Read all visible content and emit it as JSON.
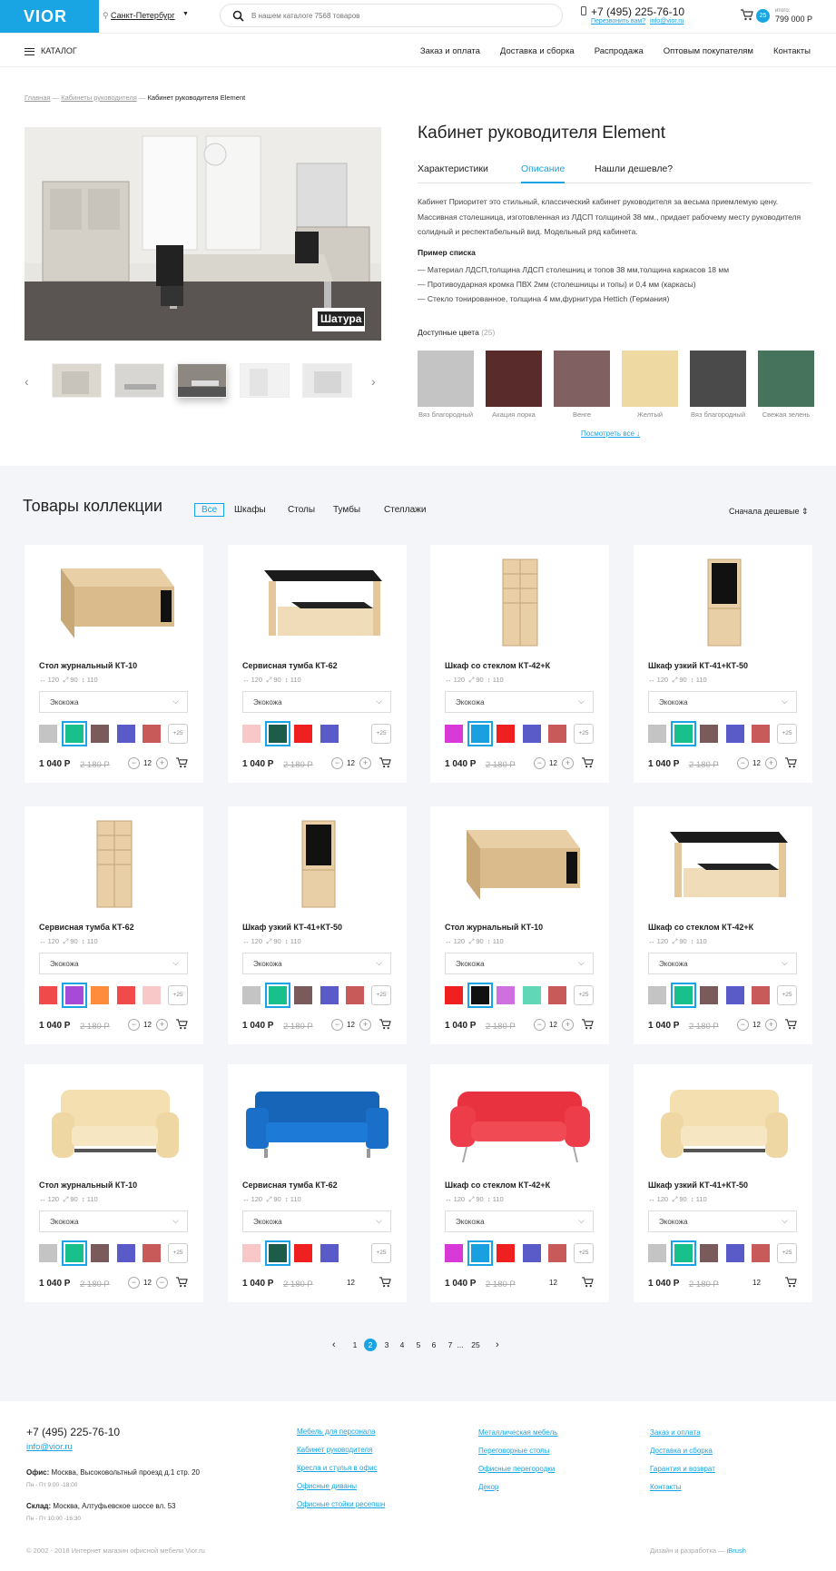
{
  "header": {
    "logo": "VIOR",
    "city": "Санкт-Петербург",
    "search_placeholder": "В нашем каталоге 7568 товаров",
    "phone": "+7 (495) 225-76-10",
    "callback": "Перезвонить вам?",
    "email": "info@vior.ru",
    "cart_count": "25",
    "cart_label": "итого:",
    "cart_total": "799 000 Р"
  },
  "nav": {
    "catalog": "КАТАЛОГ",
    "links": [
      "Заказ и оплата",
      "Доставка и сборка",
      "Распродажа",
      "Оптовым покупателям",
      "Контакты"
    ]
  },
  "breadcrumb": {
    "home": "Главная",
    "cat": "Кабинеты руководителя",
    "current": "Кабинет руководителя Element"
  },
  "product": {
    "brand": "Шатура",
    "title": "Кабинет руководителя Element",
    "tabs": [
      "Характеристики",
      "Описание",
      "Нашли дешевле?"
    ],
    "description": "Кабинет Приоритет это стильный, классический кабинет руководителя за весьма приемлемую цену. Массивная столешница, изготовленная из ЛДСП толщиной 38 мм., придает рабочему месту руководителя солидный и респектабельный вид. Модельный ряд кабинета.",
    "list_title": "Пример списка",
    "list": [
      "— Материал ЛДСП,толщина ЛДСП столешниц и топов 38 мм,толщина каркасов 18 мм",
      "— Противоударная кромка ПВХ 2мм (столешницы и топы) и 0,4 мм (каркасы)",
      "— Стекло тонированное, толщина 4 мм,фурнитура Hettich (Германия)"
    ],
    "colors_title": "Доступные цвета",
    "colors_count": "(25)",
    "colors": [
      {
        "name": "Вяз благородный",
        "hex": "#c4c4c4"
      },
      {
        "name": "Акация лорка",
        "hex": "#5a2b2b"
      },
      {
        "name": "Венге",
        "hex": "#806060"
      },
      {
        "name": "Желтый",
        "hex": "#efd9a2"
      },
      {
        "name": "Вяз благородный",
        "hex": "#4a4a4a"
      },
      {
        "name": "Свежая зелень",
        "hex": "#46735c"
      }
    ],
    "view_all": "Посмотреть все"
  },
  "collection": {
    "title": "Товары коллекции",
    "filters": [
      "Все",
      "Шкафы",
      "Столы",
      "Тумбы",
      "Стеллажи"
    ],
    "sort": "Сначала дешевые",
    "cards": [
      {
        "name": "Стол журнальный КТ-10",
        "img": "desk",
        "dims": [
          "120",
          "90",
          "110"
        ],
        "material": "Экокожа",
        "price": "1 040 Р",
        "old": "2 180 Р",
        "qty": "12",
        "colors": [
          "#c4c4c4",
          "#18c08c",
          "#7a5a5a",
          "#5a5ac8",
          "#c85a5a"
        ],
        "active": 1
      },
      {
        "name": "Сервисная тумба КТ-62",
        "img": "table",
        "dims": [
          "120",
          "90",
          "110"
        ],
        "material": "Экокожа",
        "price": "1 040 Р",
        "old": "2 180 Р",
        "qty": "12",
        "colors": [
          "#f8c8c8",
          "#1e5c4a",
          "#f02020",
          "#5a5ac8"
        ],
        "active": 1
      },
      {
        "name": "Шкаф со стеклом КТ-42+К",
        "img": "shelf",
        "dims": [
          "120",
          "90",
          "110"
        ],
        "material": "Экокожа",
        "price": "1 040 Р",
        "old": "2 180 Р",
        "qty": "12",
        "colors": [
          "#d83ad8",
          "#18a0e0",
          "#f02020",
          "#5a5ac8",
          "#c85a5a"
        ],
        "active": 1
      },
      {
        "name": "Шкаф узкий КТ-41+КТ-50",
        "img": "glass",
        "dims": [
          "120",
          "90",
          "110"
        ],
        "material": "Экокожа",
        "price": "1 040 Р",
        "old": "2 180 Р",
        "qty": "12",
        "colors": [
          "#c4c4c4",
          "#18c08c",
          "#7a5a5a",
          "#5a5ac8",
          "#c85a5a"
        ],
        "active": 1
      },
      {
        "name": "Сервисная тумба КТ-62",
        "img": "shelf",
        "dims": [
          "120",
          "90",
          "110"
        ],
        "material": "Экокожа",
        "price": "1 040 Р",
        "old": "2 180 Р",
        "qty": "12",
        "colors": [
          "#f04a4a",
          "#a84ad8",
          "#ff8c3a",
          "#f04a4a",
          "#f8c8c8"
        ],
        "active": 1
      },
      {
        "name": "Шкаф узкий КТ-41+КТ-50",
        "img": "glass",
        "dims": [
          "120",
          "90",
          "110"
        ],
        "material": "Экокожа",
        "price": "1 040 Р",
        "old": "2 180 Р",
        "qty": "12",
        "colors": [
          "#c4c4c4",
          "#18c08c",
          "#7a5a5a",
          "#5a5ac8",
          "#c85a5a"
        ],
        "active": 1
      },
      {
        "name": "Стол журнальный КТ-10",
        "img": "desk",
        "dims": [
          "120",
          "90",
          "110"
        ],
        "material": "Экокожа",
        "price": "1 040 Р",
        "old": "2 180 Р",
        "qty": "12",
        "colors": [
          "#f02020",
          "#101010",
          "#d070e0",
          "#60d8b8",
          "#c85a5a"
        ],
        "active": 1
      },
      {
        "name": "Шкаф со стеклом КТ-42+К",
        "img": "table",
        "dims": [
          "120",
          "90",
          "110"
        ],
        "material": "Экокожа",
        "price": "1 040 Р",
        "old": "2 180 Р",
        "qty": "12",
        "colors": [
          "#c4c4c4",
          "#18c08c",
          "#7a5a5a",
          "#5a5ac8",
          "#c85a5a"
        ],
        "active": 1
      },
      {
        "name": "Стол журнальный КТ-10",
        "img": "sofa-cream",
        "dims": [
          "120",
          "90",
          "110"
        ],
        "material": "Экокожа",
        "price": "1 040 Р",
        "old": "2 180 Р",
        "qty": "12",
        "colors": [
          "#c4c4c4",
          "#18c08c",
          "#7a5a5a",
          "#5a5ac8",
          "#c85a5a"
        ],
        "active": 1
      },
      {
        "name": "Сервисная тумба КТ-62",
        "img": "sofa-blue",
        "dims": [
          "120",
          "90",
          "110"
        ],
        "material": "Экокожа",
        "price": "1 040 Р",
        "old": "2 180 Р",
        "qty": "12",
        "colors": [
          "#f8c8c8",
          "#1e5c4a",
          "#f02020",
          "#5a5ac8"
        ],
        "active": 1
      },
      {
        "name": "Шкаф со стеклом КТ-42+К",
        "img": "sofa-red",
        "dims": [
          "120",
          "90",
          "110"
        ],
        "material": "Экокожа",
        "price": "1 040 Р",
        "old": "2 180 Р",
        "qty": "12",
        "colors": [
          "#d83ad8",
          "#18a0e0",
          "#f02020",
          "#5a5ac8",
          "#c85a5a"
        ],
        "active": 1
      },
      {
        "name": "Шкаф узкий КТ-41+КТ-50",
        "img": "sofa-cream",
        "dims": [
          "120",
          "90",
          "110"
        ],
        "material": "Экокожа",
        "price": "1 040 Р",
        "old": "2 180 Р",
        "qty": "12",
        "colors": [
          "#c4c4c4",
          "#18c08c",
          "#7a5a5a",
          "#5a5ac8",
          "#c85a5a"
        ],
        "active": 1
      }
    ],
    "more_colors": "+25"
  },
  "pager": {
    "pages": [
      "1",
      "2",
      "3",
      "4",
      "5",
      "6",
      "7",
      "...",
      "25"
    ],
    "active": "2"
  },
  "footer": {
    "phone": "+7 (495) 225-76-10",
    "email": "info@vior.ru",
    "office_label": "Офис:",
    "office": "Москва, Высоковольтный проезд д.1 стр. 20",
    "office_hours": "Пн - Пт 9:00 -18:00",
    "store_label": "Склад:",
    "store": "Москва, Алтуфьевское шоссе вл. 53",
    "store_hours": "Пн - Пт 10:00 -16:30",
    "col1": [
      "Мебель для персонала",
      "Кабинет руководителя",
      "Кресла и стулья в офис",
      "Офисные диваны",
      "Офисные стойки ресепшн"
    ],
    "col2": [
      "Металлическая мебель",
      "Переговорные столы",
      "Офисные перегородки",
      "Декор"
    ],
    "col3": [
      "Заказ и оплата",
      "Доставка и сборка",
      "Гарантия и возврат",
      "Контакты"
    ],
    "copyright": "© 2002 - 2018 Интернет магазин офисной мебели Vior.ru",
    "design": "Дизайн и разработка —",
    "design_brand": "iBrush"
  }
}
